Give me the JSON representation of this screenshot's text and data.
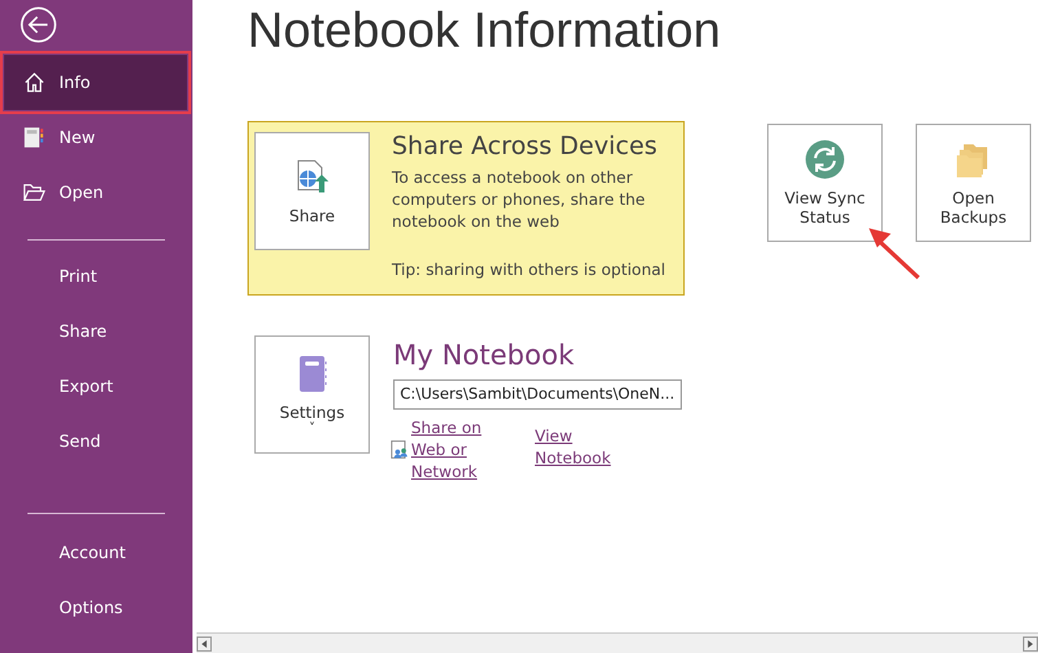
{
  "sidebar": {
    "groups": [
      {
        "items": [
          {
            "label": "Info",
            "kind": "home",
            "selected": true
          },
          {
            "label": "New",
            "kind": "new",
            "selected": false
          },
          {
            "label": "Open",
            "kind": "open",
            "selected": false
          }
        ]
      },
      {
        "items": [
          {
            "label": "Print",
            "kind": "plain",
            "selected": false
          },
          {
            "label": "Share",
            "kind": "plain",
            "selected": false
          },
          {
            "label": "Export",
            "kind": "plain",
            "selected": false
          },
          {
            "label": "Send",
            "kind": "plain",
            "selected": false
          }
        ]
      },
      {
        "items": [
          {
            "label": "Account",
            "kind": "plain",
            "selected": false
          },
          {
            "label": "Options",
            "kind": "plain",
            "selected": false
          }
        ]
      }
    ]
  },
  "title": "Notebook Information",
  "share_card": {
    "button": "Share",
    "heading": "Share Across Devices",
    "text": "To access a notebook on other computers or phones, share the notebook on the web",
    "tip": "Tip: sharing with others is optional"
  },
  "tiles": [
    {
      "label": "View Sync Status",
      "kind": "sync"
    },
    {
      "label": "Open Backups",
      "kind": "backups"
    }
  ],
  "notebook": {
    "button": "Settings",
    "caret": "˅",
    "name": "My Notebook",
    "path": "C:\\Users\\Sambit\\Documents\\OneN...",
    "links": [
      {
        "label": "Share on Web or Network",
        "kind": "share"
      },
      {
        "label": "View Notebook",
        "kind": "plain"
      }
    ]
  }
}
